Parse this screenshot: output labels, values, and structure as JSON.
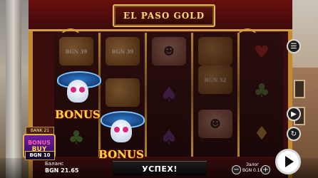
{
  "game": {
    "title": "EL PASO GOLD"
  },
  "reels": {
    "bonus_label": "BONUS",
    "faded_label_1": "BGN 39",
    "faded_label_2": "BGN 39",
    "faded_label_3": "BGN 32"
  },
  "bonus_buy": {
    "bank_label": "BANK 21",
    "line1": "BONUS",
    "line2": "BUY",
    "price": "BGN 10"
  },
  "message": {
    "text": "УСПЕХ!"
  },
  "balance": {
    "label": "Баланс",
    "value": "BGN 21.65"
  },
  "bet": {
    "label": "Залог",
    "value": "BGN 0.10"
  },
  "controls": {
    "minus": "−",
    "plus": "+"
  },
  "icons": {
    "menu": "menu-icon",
    "play": "play-icon",
    "autoplay": "autoplay-icon",
    "turbo": "turbo-icon",
    "spin": "spin-icon"
  },
  "colors": {
    "frame_gold": "#c48a2e",
    "frame_red": "#3a0d0d",
    "bonus_text": "#ffd24a"
  }
}
